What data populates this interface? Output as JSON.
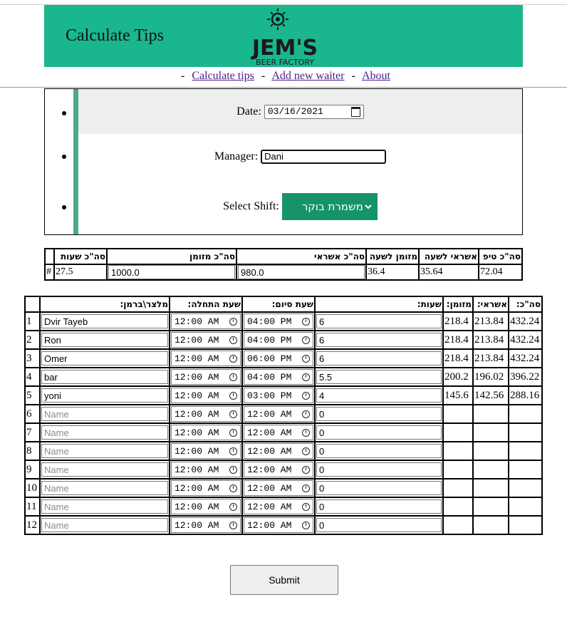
{
  "header": {
    "title": "Calculate Tips",
    "logo_text": "JEM'S",
    "logo_subtext": "BEER FACTORY"
  },
  "nav": {
    "items": [
      "Calculate tips",
      "Add new waiter",
      "About"
    ]
  },
  "form": {
    "date_label": "Date:",
    "date_value": "03/16/2021",
    "manager_label": "Manager:",
    "manager_value": "Dani",
    "shift_label": "Select Shift:",
    "shift_value": "משמרת בוקר"
  },
  "summary": {
    "headers": [
      "סה\"כ שעות",
      "סה\"כ מזומן",
      "סה\"כ אשראי",
      "מזומן לשעה",
      "אשראי לשעה",
      "סה\"כ טיפ"
    ],
    "row_label": "#",
    "values": {
      "total_hours": "27.5",
      "total_cash": "1000.0",
      "total_credit": "980.0",
      "cash_per_hour": "36.4",
      "credit_per_hour": "35.64",
      "total_tip": "72.04"
    }
  },
  "waiters": {
    "headers": {
      "name": "מלצר\\ברמן:",
      "start": "שעת התחלה:",
      "end": "שעת סיום:",
      "hours": "שעות:",
      "cash": "מזומן:",
      "credit": "אשראי:",
      "total": "סה\"כ:"
    },
    "name_placeholder": "Name",
    "rows": [
      {
        "num": "1",
        "name": "Dvir Tayeb",
        "start": "12:00 AM",
        "end": "04:00 PM",
        "hours": "6",
        "cash": "218.4",
        "credit": "213.84",
        "total": "432.24"
      },
      {
        "num": "2",
        "name": "Ron",
        "start": "12:00 AM",
        "end": "04:00 PM",
        "hours": "6",
        "cash": "218.4",
        "credit": "213.84",
        "total": "432.24"
      },
      {
        "num": "3",
        "name": "Omer",
        "start": "12:00 AM",
        "end": "06:00 PM",
        "hours": "6",
        "cash": "218.4",
        "credit": "213.84",
        "total": "432.24"
      },
      {
        "num": "4",
        "name": "bar",
        "start": "12:00 AM",
        "end": "04:00 PM",
        "hours": "5.5",
        "cash": "200.2",
        "credit": "196.02",
        "total": "396.22"
      },
      {
        "num": "5",
        "name": "yoni",
        "start": "12:00 AM",
        "end": "03:00 PM",
        "hours": "4",
        "cash": "145.6",
        "credit": "142.56",
        "total": "288.16"
      },
      {
        "num": "6",
        "name": "",
        "start": "12:00 AM",
        "end": "12:00 AM",
        "hours": "0",
        "cash": "",
        "credit": "",
        "total": ""
      },
      {
        "num": "7",
        "name": "",
        "start": "12:00 AM",
        "end": "12:00 AM",
        "hours": "0",
        "cash": "",
        "credit": "",
        "total": ""
      },
      {
        "num": "8",
        "name": "",
        "start": "12:00 AM",
        "end": "12:00 AM",
        "hours": "0",
        "cash": "",
        "credit": "",
        "total": ""
      },
      {
        "num": "9",
        "name": "",
        "start": "12:00 AM",
        "end": "12:00 AM",
        "hours": "0",
        "cash": "",
        "credit": "",
        "total": ""
      },
      {
        "num": "10",
        "name": "",
        "start": "12:00 AM",
        "end": "12:00 AM",
        "hours": "0",
        "cash": "",
        "credit": "",
        "total": ""
      },
      {
        "num": "11",
        "name": "",
        "start": "12:00 AM",
        "end": "12:00 AM",
        "hours": "0",
        "cash": "",
        "credit": "",
        "total": ""
      },
      {
        "num": "12",
        "name": "",
        "start": "12:00 AM",
        "end": "12:00 AM",
        "hours": "0",
        "cash": "",
        "credit": "",
        "total": ""
      }
    ]
  },
  "submit_label": "Submit",
  "colors": {
    "header_bg": "#1ab68e",
    "select_bg": "#169468",
    "accent_bar": "#4caa86",
    "link": "#4b1a8c"
  }
}
